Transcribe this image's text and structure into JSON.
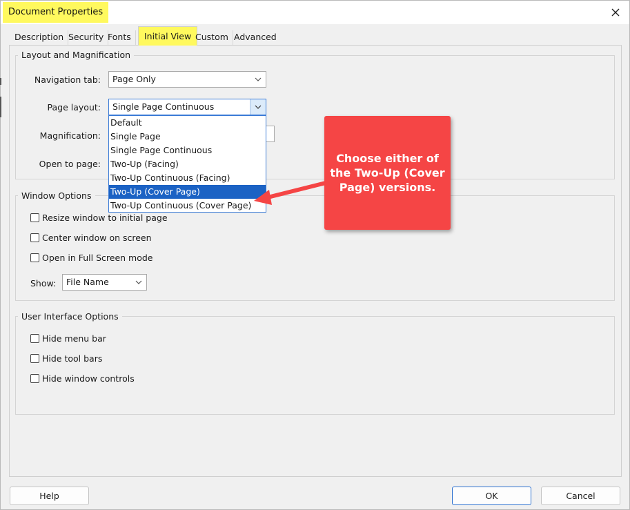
{
  "window": {
    "title": "Document Properties",
    "close_icon": "close-icon"
  },
  "tabs": [
    {
      "label": "Description"
    },
    {
      "label": "Security"
    },
    {
      "label": "Fonts"
    },
    {
      "label": "Initial View",
      "active": true
    },
    {
      "label": "Custom"
    },
    {
      "label": "Advanced"
    }
  ],
  "layout_group": {
    "title": "Layout and Magnification",
    "navigation_tab": {
      "label": "Navigation tab:",
      "value": "Page Only"
    },
    "page_layout": {
      "label": "Page layout:",
      "value": "Single Page Continuous",
      "options": [
        "Default",
        "Single Page",
        "Single Page Continuous",
        "Two-Up (Facing)",
        "Two-Up Continuous (Facing)",
        "Two-Up (Cover Page)",
        "Two-Up Continuous (Cover Page)"
      ],
      "highlighted_option": "Two-Up (Cover Page)"
    },
    "magnification": {
      "label": "Magnification:"
    },
    "open_to_page": {
      "label": "Open to page:"
    }
  },
  "window_options": {
    "title": "Window Options",
    "checkboxes": [
      {
        "label": "Resize window to initial page",
        "checked": false
      },
      {
        "label": "Center window on screen",
        "checked": false
      },
      {
        "label": "Open in Full Screen mode",
        "checked": false
      }
    ],
    "show": {
      "label": "Show:",
      "value": "File Name"
    }
  },
  "ui_options": {
    "title": "User Interface Options",
    "checkboxes": [
      {
        "label": "Hide menu bar",
        "checked": false
      },
      {
        "label": "Hide tool bars",
        "checked": false
      },
      {
        "label": "Hide window controls",
        "checked": false
      }
    ]
  },
  "callout": {
    "text": "Choose either of the  Two-Up (Cover Page) versions."
  },
  "buttons": {
    "help": "Help",
    "ok": "OK",
    "cancel": "Cancel"
  },
  "colors": {
    "highlight_yellow": "#fff95e",
    "callout_red": "#f54545",
    "selection_blue": "#1b62c4",
    "focus_blue": "#3b7bd6"
  }
}
